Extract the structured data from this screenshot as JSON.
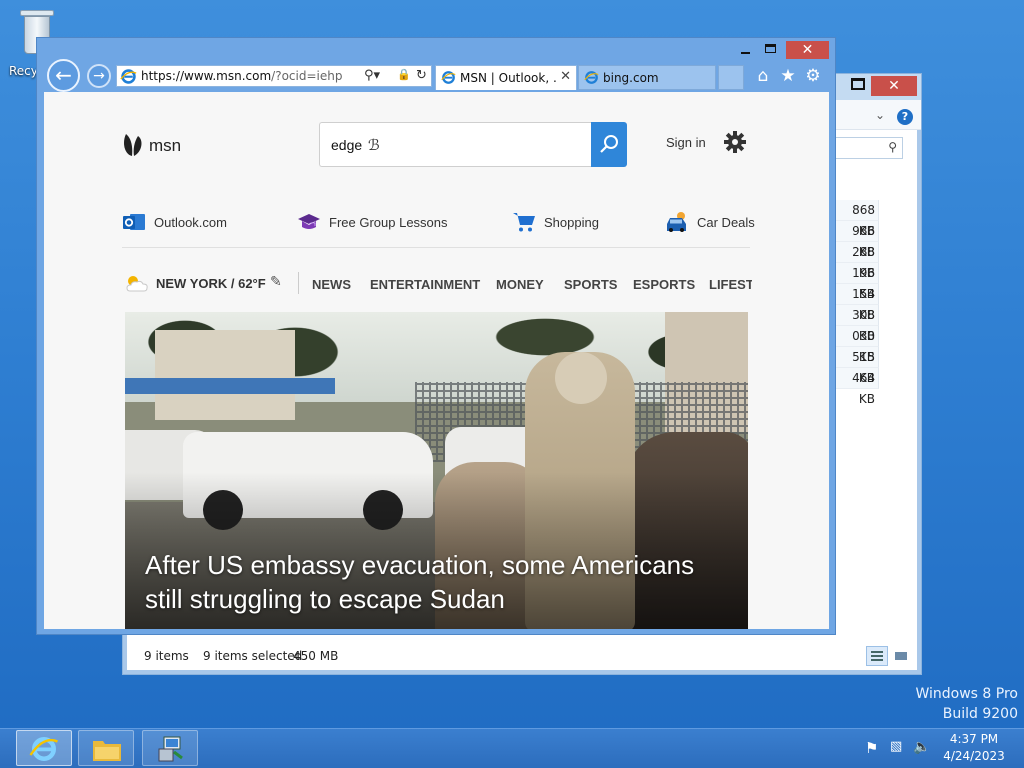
{
  "desktop": {
    "recycle_bin_label": "Recyc",
    "watermark_line1": "Windows 8 Pro",
    "watermark_line2": "Build 9200"
  },
  "explorer": {
    "close_glyph": "✕",
    "file_sizes": [
      "868 KB",
      "986 KB",
      "288 KB",
      "196 KB",
      "154 KB",
      "308 KB",
      "030 KB",
      "515 KB",
      "464 KB"
    ],
    "status_items": "9 items",
    "status_selected": "9 items selected",
    "status_size": "450 MB"
  },
  "ie": {
    "address_host": "https://www.msn.com",
    "address_path": "/?ocid=iehp",
    "tabs": [
      {
        "label": "MSN | Outlook, ...",
        "active": true
      },
      {
        "label": "bing.com",
        "active": false
      }
    ],
    "close_glyph": "✕"
  },
  "msn": {
    "logo_text": "msn",
    "search_value": "edge",
    "sign_in": "Sign in",
    "quick_links": [
      {
        "label": "Outlook.com",
        "icon": "outlook-icon"
      },
      {
        "label": "Free Group Lessons",
        "icon": "graduation-cap-icon"
      },
      {
        "label": "Shopping",
        "icon": "shopping-cart-icon"
      },
      {
        "label": "Car Deals",
        "icon": "car-icon"
      }
    ],
    "weather": "NEW YORK / 62°F",
    "nav": [
      "NEWS",
      "ENTERTAINMENT",
      "MONEY",
      "SPORTS",
      "ESPORTS",
      "LIFESTYLE"
    ],
    "headline": "After US embassy evacuation, some Americans still struggling to escape Sudan"
  },
  "taskbar": {
    "time": "4:37 PM",
    "date": "4/24/2023"
  },
  "colors": {
    "accent": "#2f86d9",
    "close_red": "#c9504a",
    "desktop_blue": "#2f7fd2"
  }
}
